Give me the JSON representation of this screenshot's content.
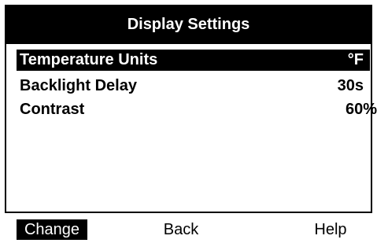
{
  "header": {
    "title": "Display Settings"
  },
  "menu": {
    "items": [
      {
        "label": "Temperature Units",
        "value": "°F",
        "selected": true
      },
      {
        "label": "Backlight Delay",
        "value": "30s",
        "selected": false
      },
      {
        "label": "Contrast",
        "value": "60%",
        "selected": false
      }
    ]
  },
  "softkeys": [
    {
      "label": "Change",
      "selected": true
    },
    {
      "label": "Back",
      "selected": false
    },
    {
      "label": "Help",
      "selected": false
    }
  ],
  "colors": {
    "foreground": "#000000",
    "background": "#ffffff",
    "highlight": "#000000",
    "highlight_text": "#ffffff"
  }
}
